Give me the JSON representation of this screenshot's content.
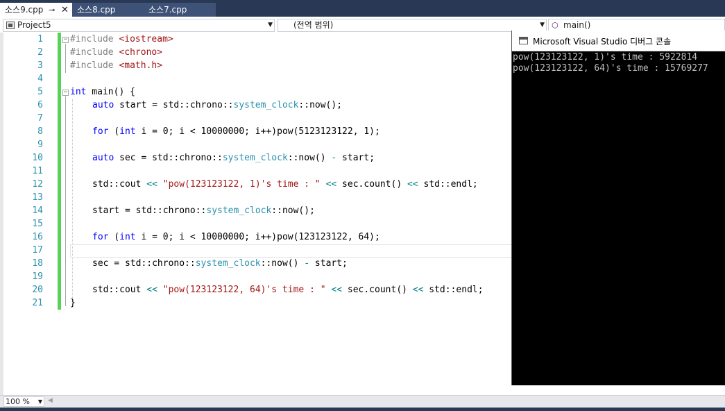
{
  "tabs": [
    {
      "label": "소스9.cpp",
      "active": true
    },
    {
      "label": "소스8.cpp",
      "active": false
    },
    {
      "label": "소스7.cpp",
      "active": false
    }
  ],
  "tab_pin_glyph": "⊸",
  "tab_close_glyph": "✕",
  "navbar": {
    "project": "Project5",
    "scope": "(전역 범위)",
    "member": "main()"
  },
  "line_numbers": [
    "1",
    "2",
    "3",
    "4",
    "5",
    "6",
    "7",
    "8",
    "9",
    "10",
    "11",
    "12",
    "13",
    "14",
    "15",
    "16",
    "17",
    "18",
    "19",
    "20",
    "21"
  ],
  "code": {
    "l1": {
      "pp": "#include ",
      "str": "<iostream>"
    },
    "l2": {
      "pp": "#include ",
      "str": "<chrono>"
    },
    "l3": {
      "pp": "#include ",
      "str": "<math.h>"
    },
    "l5": {
      "kw": "int",
      "rest": " main() {"
    },
    "l6": {
      "kw": "auto",
      "a": " start = std::chrono::",
      "ty": "system_clock",
      "b": "::now();"
    },
    "l8": {
      "kw1": "for",
      "a": " (",
      "kw2": "int",
      "b": " i = 0; i < 10000000; i++)pow(5123123122, 1);"
    },
    "l10": {
      "kw": "auto",
      "a": " sec = std::chrono::",
      "ty": "system_clock",
      "b": "::now() ",
      "op": "-",
      "c": " start;"
    },
    "l12": {
      "a": "std::cout ",
      "op1": "<<",
      "s": " \"pow(123123122, 1)'s time : \" ",
      "op2": "<<",
      "b": " sec.count() ",
      "op3": "<<",
      "c": " std::endl;"
    },
    "l14": {
      "a": "start = std::chrono::",
      "ty": "system_clock",
      "b": "::now();"
    },
    "l16": {
      "kw1": "for",
      "a": " (",
      "kw2": "int",
      "b": " i = 0; i < 10000000; i++)pow(123123122, 64);"
    },
    "l18": {
      "a": "sec = std::chrono::",
      "ty": "system_clock",
      "b": "::now() ",
      "op": "-",
      "c": " start;"
    },
    "l20": {
      "a": "std::cout ",
      "op1": "<<",
      "s": " \"pow(123123122, 64)'s time : \" ",
      "op2": "<<",
      "b": " sec.count() ",
      "op3": "<<",
      "c": " std::endl;"
    },
    "l21": {
      "a": "}"
    }
  },
  "console": {
    "title": "Microsoft Visual Studio 디버그 콘솔",
    "lines": [
      "pow(123123122, 1)'s time : 5922814",
      "pow(123123122, 64)'s time : 15769277"
    ]
  },
  "zoom": "100 %",
  "colors": {
    "keyword": "#0000ff",
    "preprocessor": "#808080",
    "string": "#a31515",
    "type": "#2b91af",
    "operator": "#008080",
    "line_number": "#2b91af",
    "change_bar": "#57d157",
    "chrome": "#293955"
  },
  "icons": [
    "pin-icon",
    "close-icon",
    "project-icon",
    "dropdown-arrow-icon",
    "cube-icon",
    "console-window-icon",
    "fold-icon"
  ]
}
